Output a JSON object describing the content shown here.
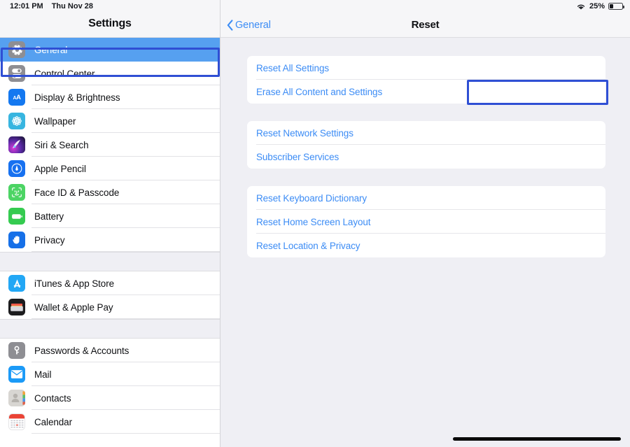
{
  "status_bar": {
    "time": "12:01 PM",
    "date": "Thu Nov 28",
    "wifi_icon": "wifi-icon",
    "battery_percent": "25%",
    "battery_level": 25,
    "battery_icon": "battery-icon"
  },
  "sidebar": {
    "title": "Settings",
    "groups": [
      {
        "items": [
          {
            "label": "General",
            "icon": "gear-icon",
            "icon_class": "ic-general",
            "glyph": "gear",
            "selected": true
          },
          {
            "label": "Control Center",
            "icon": "sliders-icon",
            "icon_class": "ic-control",
            "glyph": "sliders",
            "selected": false
          },
          {
            "label": "Display & Brightness",
            "icon": "text-size-icon",
            "icon_class": "ic-display",
            "glyph": "AA",
            "selected": false
          },
          {
            "label": "Wallpaper",
            "icon": "flower-icon",
            "icon_class": "ic-wallpaper",
            "glyph": "flower",
            "selected": false
          },
          {
            "label": "Siri & Search",
            "icon": "siri-icon",
            "icon_class": "ic-siri",
            "glyph": "siri",
            "selected": false
          },
          {
            "label": "Apple Pencil",
            "icon": "apple-pencil-icon",
            "icon_class": "ic-pencil",
            "glyph": "pencil",
            "selected": false
          },
          {
            "label": "Face ID & Passcode",
            "icon": "face-id-icon",
            "icon_class": "ic-faceid",
            "glyph": "face",
            "selected": false
          },
          {
            "label": "Battery",
            "icon": "battery-icon",
            "icon_class": "ic-battery",
            "glyph": "battery",
            "selected": false
          },
          {
            "label": "Privacy",
            "icon": "hand-icon",
            "icon_class": "ic-privacy",
            "glyph": "hand",
            "selected": false
          }
        ]
      },
      {
        "items": [
          {
            "label": "iTunes & App Store",
            "icon": "app-store-icon",
            "icon_class": "ic-itunes",
            "glyph": "appstore",
            "selected": false
          },
          {
            "label": "Wallet & Apple Pay",
            "icon": "wallet-icon",
            "icon_class": "ic-wallet",
            "glyph": "wallet",
            "selected": false
          }
        ]
      },
      {
        "items": [
          {
            "label": "Passwords & Accounts",
            "icon": "key-icon",
            "icon_class": "ic-passwords",
            "glyph": "key",
            "selected": false
          },
          {
            "label": "Mail",
            "icon": "mail-icon",
            "icon_class": "ic-mail",
            "glyph": "mail",
            "selected": false
          },
          {
            "label": "Contacts",
            "icon": "contacts-icon",
            "icon_class": "ic-contacts",
            "glyph": "contacts",
            "selected": false
          },
          {
            "label": "Calendar",
            "icon": "calendar-icon",
            "icon_class": "ic-calendar",
            "glyph": "calendar",
            "selected": false
          }
        ]
      }
    ]
  },
  "detail": {
    "back_label": "General",
    "back_icon": "chevron-left-icon",
    "title": "Reset",
    "groups": [
      {
        "items": [
          {
            "label": "Reset All Settings",
            "highlighted": false
          },
          {
            "label": "Erase All Content and Settings",
            "highlighted": true
          }
        ]
      },
      {
        "items": [
          {
            "label": "Reset Network Settings",
            "highlighted": false
          },
          {
            "label": "Subscriber Services",
            "highlighted": false
          }
        ]
      },
      {
        "items": [
          {
            "label": "Reset Keyboard Dictionary",
            "highlighted": false
          },
          {
            "label": "Reset Home Screen Layout",
            "highlighted": false
          },
          {
            "label": "Reset Location & Privacy",
            "highlighted": false
          }
        ]
      }
    ]
  },
  "annotations": {
    "color": "#2f4fd4",
    "boxes": [
      {
        "target": "General",
        "region": "sidebar"
      },
      {
        "target": "Erase All Content and Settings",
        "region": "detail"
      }
    ]
  },
  "colors": {
    "accent_blue": "#3c8cf5",
    "selection_blue": "#56a0f0",
    "panel_gray": "#efeff4",
    "card_white": "#ffffff",
    "annotation_blue": "#2f4fd4"
  },
  "home_indicator": {
    "visible": true
  }
}
